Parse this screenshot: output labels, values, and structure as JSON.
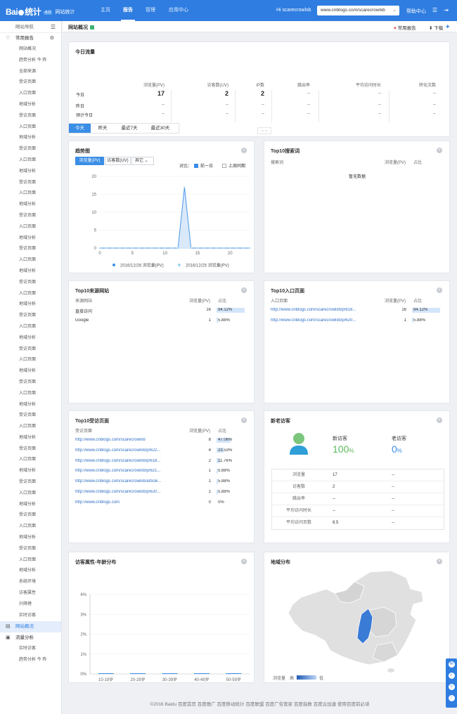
{
  "header": {
    "logo_text": "Bai",
    "logo_text2": "统计",
    "badge": "4.0",
    "subtitle": "网站统计",
    "nav": [
      "主页",
      "报告",
      "管理",
      "应用中心"
    ],
    "active_nav": "报告",
    "greeting": "Hi scarecrowlxb",
    "site": "www.cnblogs.com/scarecrowlxb",
    "help": "帮助中心"
  },
  "sidebar": {
    "head": "网站导航",
    "section_common": "常用报告",
    "items_common": [
      "网站概况",
      "趋势分析  今  昨",
      "全部来源",
      "受访页面",
      "入口页面",
      "地域分析",
      "受访页面",
      "入口页面",
      "地域分析",
      "受访页面",
      "入口页面",
      "地域分析",
      "受访页面",
      "入口页面",
      "地域分析",
      "受访页面",
      "入口页面",
      "地域分析",
      "受访页面",
      "入口页面",
      "地域分析",
      "受访页面",
      "入口页面",
      "地域分析",
      "受访页面",
      "入口页面",
      "地域分析",
      "受访页面",
      "入口页面",
      "地域分析",
      "受访页面",
      "入口页面",
      "地域分析",
      "受访页面",
      "入口页面",
      "地域分析",
      "受访页面",
      "入口页面",
      "地域分析",
      "受访页面",
      "入口页面",
      "地域分析",
      "受访页面",
      "入口页面",
      "地域分析",
      "受访页面",
      "入口页面",
      "地域分析",
      "系统环境",
      "访客属性",
      "升降榜",
      "实时访客"
    ],
    "section_overview": "网站概况",
    "section_flow": "流量分析",
    "items_flow": [
      "实时访客",
      "趋势分析  今  昨"
    ]
  },
  "crumb": {
    "title": "网站概况",
    "fav": "常用报告",
    "download": "下载"
  },
  "today": {
    "title": "今日流量",
    "headers": [
      "浏览量(PV)",
      "访客数(UV)",
      "IP数",
      "跳出率",
      "平均访问时长",
      "转化次数"
    ],
    "rows": [
      {
        "label": "今日",
        "values": [
          "17",
          "2",
          "2",
          "--",
          "--",
          "--"
        ]
      },
      {
        "label": "昨日",
        "values": [
          "--",
          "--",
          "--",
          "--",
          "--",
          "--"
        ]
      },
      {
        "label": "预计今日",
        "values": [
          "--",
          "--",
          "--",
          "--",
          "--",
          "--"
        ]
      }
    ]
  },
  "date_tabs": [
    "今天",
    "昨天",
    "最近7天",
    "最近30天"
  ],
  "trend": {
    "title": "趋势图",
    "tabs": [
      "浏览量(PV)",
      "访客数(UV)",
      "其它"
    ],
    "compare_label": "对比：",
    "compare": [
      "前一日",
      "上周同期"
    ],
    "legend": [
      "2016/12/26 浏览量(PV)",
      "2016/12/25 浏览量(PV)"
    ],
    "colors": {
      "primary": "#3a8ee6",
      "secondary": "#9fd4f0"
    }
  },
  "chart_data": {
    "type": "line",
    "x": [
      0,
      1,
      2,
      3,
      4,
      5,
      6,
      7,
      8,
      9,
      10,
      11,
      12,
      13,
      14,
      15,
      16,
      17,
      18,
      19,
      20,
      21,
      22,
      23
    ],
    "series": [
      {
        "name": "2016/12/26 浏览量(PV)",
        "values": [
          0,
          0,
          0,
          0,
          0,
          0,
          0,
          0,
          0,
          0,
          0,
          0,
          0,
          17,
          0,
          0,
          0,
          0,
          0,
          0,
          0,
          0,
          0,
          0
        ]
      },
      {
        "name": "2016/12/25 浏览量(PV)",
        "values": [
          0,
          0,
          0,
          0,
          0,
          0,
          0,
          0,
          0,
          0,
          0,
          0,
          0,
          0,
          0,
          0,
          0,
          0,
          0,
          0,
          0,
          0,
          0,
          0
        ]
      }
    ],
    "xticks": [
      "0",
      "5",
      "10",
      "15",
      "20"
    ],
    "yticks": [
      "0",
      "5",
      "10",
      "15",
      "20"
    ],
    "ylim": [
      0,
      20
    ]
  },
  "keywords": {
    "title": "Top10搜索词",
    "headers": [
      "搜索词",
      "浏览量(PV)",
      "占比"
    ],
    "empty": "暂无数据"
  },
  "sources": {
    "title": "Top10来源网站",
    "headers": [
      "来源网站",
      "浏览量(PV)",
      "占比"
    ],
    "rows": [
      {
        "name": "直接访问",
        "pv": "16",
        "pct": "94.12%",
        "frac": 0.9412
      },
      {
        "name": "Google",
        "pv": "1",
        "pct": "5.88%",
        "frac": 0.0588
      }
    ]
  },
  "entry": {
    "title": "Top10入口页面",
    "headers": [
      "入口页面",
      "浏览量(PV)",
      "占比"
    ],
    "rows": [
      {
        "name": "http://www.cnblogs.com/scarecrowlxb/p/618...",
        "pv": "16",
        "pct": "94.12%",
        "frac": 0.9412
      },
      {
        "name": "http://www.cnblogs.com/scarecrowlxb/p/620...",
        "pv": "1",
        "pct": "5.88%",
        "frac": 0.0588
      }
    ]
  },
  "visited": {
    "title": "Top10受访页面",
    "headers": [
      "受访页面",
      "浏览量(PV)",
      "占比"
    ],
    "rows": [
      {
        "name": "http://www.cnblogs.com/scarecrowlxb",
        "pv": "8",
        "pct": "47.06%",
        "frac": 0.4706
      },
      {
        "name": "http://www.cnblogs.com/scarecrowlxb/p/622...",
        "pv": "4",
        "pct": "23.53%",
        "frac": 0.2353
      },
      {
        "name": "http://www.cnblogs.com/scarecrowlxb/p/618...",
        "pv": "2",
        "pct": "11.76%",
        "frac": 0.1176
      },
      {
        "name": "http://www.cnblogs.com/scarecrowlxb/p/621...",
        "pv": "1",
        "pct": "5.88%",
        "frac": 0.0588
      },
      {
        "name": "http://www.cnblogs.com/scarecrowlxb/article...",
        "pv": "1",
        "pct": "5.88%",
        "frac": 0.0588
      },
      {
        "name": "http://www.cnblogs.com/scarecrowlxb/p/620...",
        "pv": "1",
        "pct": "5.88%",
        "frac": 0.0588
      },
      {
        "name": "http://www.cnblogs.com",
        "pv": "0",
        "pct": "0%",
        "frac": 0
      }
    ]
  },
  "newold": {
    "title": "新老访客",
    "new_label": "新访客",
    "new_value": "100",
    "old_label": "老访客",
    "old_value": "0",
    "pct_sign": "%",
    "rows": [
      {
        "label": "浏览量",
        "new": "17",
        "old": "--"
      },
      {
        "label": "访客数",
        "new": "2",
        "old": "--"
      },
      {
        "label": "跳出率",
        "new": "--",
        "old": "--"
      },
      {
        "label": "平均访问时长",
        "new": "--",
        "old": "--"
      },
      {
        "label": "平均访问页数",
        "new": "8.5",
        "old": "--"
      }
    ]
  },
  "age": {
    "title": "访客属性-年龄分布",
    "yticks": [
      "0%",
      "1%",
      "2%",
      "3%",
      "4%"
    ],
    "categories": [
      "10-19岁",
      "20-29岁",
      "30-39岁",
      "40-49岁",
      "50-59岁"
    ]
  },
  "geo": {
    "title": "地域分布",
    "legend_label": "浏览量",
    "legend_high": "高",
    "legend_low": "低"
  },
  "footer": "©2016 Baidu   百度首页   百度推广   百度移动统计   百度联盟   百度广告管家   百度指数   百度云加速   使用百度前必读"
}
